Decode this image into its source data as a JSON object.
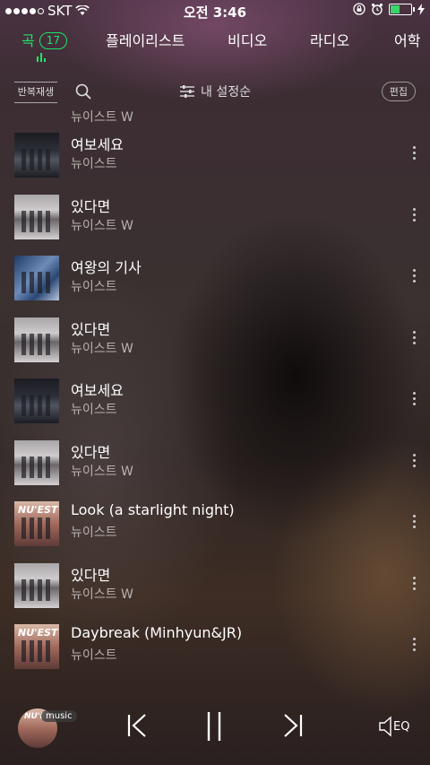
{
  "status_bar": {
    "carrier": "SKT",
    "time": "오전 3:46"
  },
  "tabs": [
    {
      "label": "곡",
      "badge": "17",
      "active": true
    },
    {
      "label": "플레이리스트"
    },
    {
      "label": "비디오"
    },
    {
      "label": "라디오"
    },
    {
      "label": "어학"
    }
  ],
  "toolbar": {
    "repeat_label": "반복재생",
    "sort_label": "내 설정순",
    "edit_label": "편집"
  },
  "song_list": {
    "partial_artist": "뉴이스트 W",
    "songs": [
      {
        "title": "여보세요",
        "artist": "뉴이스트",
        "art": "art-b"
      },
      {
        "title": "있다면",
        "artist": "뉴이스트 W",
        "art": "art-a"
      },
      {
        "title": "여왕의 기사",
        "artist": "뉴이스트",
        "art": "art-c"
      },
      {
        "title": "있다면",
        "artist": "뉴이스트 W",
        "art": "art-a"
      },
      {
        "title": "여보세요",
        "artist": "뉴이스트",
        "art": "art-b"
      },
      {
        "title": "있다면",
        "artist": "뉴이스트 W",
        "art": "art-a"
      },
      {
        "title": "Look (a starlight night)",
        "artist": "뉴이스트",
        "art": "art-d",
        "logo": "NU'EST"
      },
      {
        "title": "있다면",
        "artist": "뉴이스트 W",
        "art": "art-a"
      },
      {
        "title": "Daybreak (Minhyun&JR)",
        "artist": "뉴이스트",
        "art": "art-d",
        "logo": "NU'EST"
      }
    ]
  },
  "player": {
    "source_label": "music",
    "eq_label": "EQ",
    "mini_logo": "NU'EST"
  },
  "colors": {
    "accent": "#1ee567"
  }
}
